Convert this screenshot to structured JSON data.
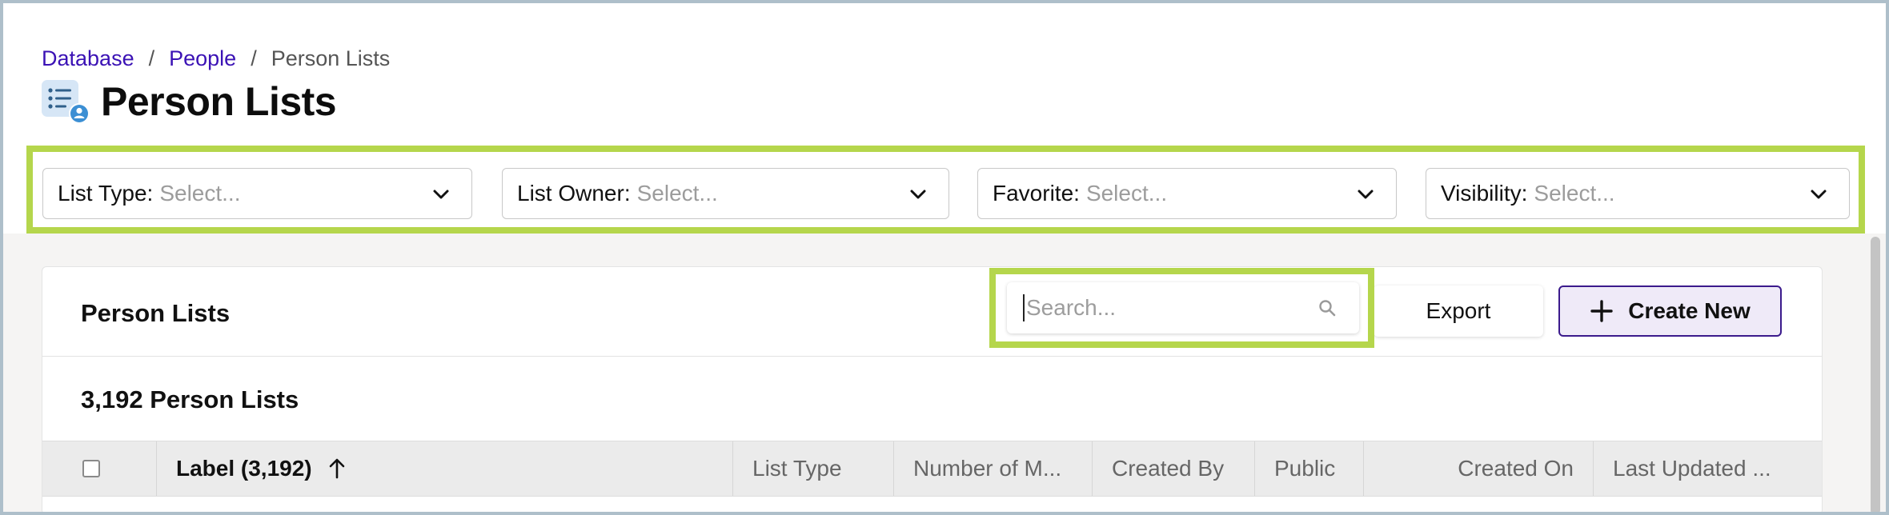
{
  "breadcrumb": {
    "items": [
      "Database",
      "People"
    ],
    "separator": "/",
    "current": "Person Lists"
  },
  "page": {
    "title": "Person Lists",
    "icon": "person-list-icon"
  },
  "filters": [
    {
      "label": "List Type:",
      "placeholder": "Select..."
    },
    {
      "label": "List Owner:",
      "placeholder": "Select..."
    },
    {
      "label": "Favorite:",
      "placeholder": "Select..."
    },
    {
      "label": "Visibility:",
      "placeholder": "Select..."
    }
  ],
  "card": {
    "title": "Person Lists",
    "count_label": "3,192 Person Lists"
  },
  "search": {
    "placeholder": "Search...",
    "value": ""
  },
  "actions": {
    "export_label": "Export",
    "create_label": "Create New"
  },
  "table": {
    "columns": [
      {
        "label": "Label (3,192)",
        "sorted": "ascending"
      },
      {
        "label": "List Type"
      },
      {
        "label": "Number of M..."
      },
      {
        "label": "Created By"
      },
      {
        "label": "Public"
      },
      {
        "label": "Created On"
      },
      {
        "label": "Last Updated ..."
      }
    ]
  },
  "colors": {
    "link": "#3b12b5",
    "highlight_border": "#b5d64c",
    "create_button_border": "#3b1a8c",
    "create_button_bg": "#efeaf8",
    "content_bg": "#f5f4f3",
    "table_header_bg": "#ebebeb"
  }
}
